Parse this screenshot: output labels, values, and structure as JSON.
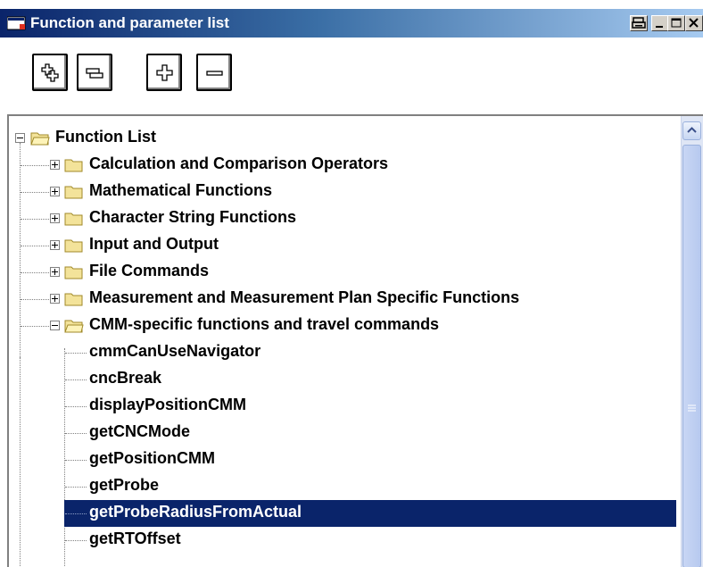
{
  "window": {
    "title": "Function and parameter list",
    "title_buttons": [
      "print-icon",
      "minimize-icon",
      "maximize-icon",
      "close-icon"
    ],
    "colors": {
      "title_start": "#0a246a",
      "title_end": "#a6caf0",
      "selection": "#0a246a"
    }
  },
  "toolbar": {
    "buttons": [
      "expand-all-icon",
      "collapse-all-icon",
      "expand-icon",
      "collapse-icon"
    ]
  },
  "tree": {
    "root": {
      "label": "Function List",
      "state": "expanded"
    },
    "categories": [
      {
        "label": "Calculation and Comparison Operators",
        "state": "collapsed"
      },
      {
        "label": "Mathematical Functions",
        "state": "collapsed"
      },
      {
        "label": "Character String Functions",
        "state": "collapsed"
      },
      {
        "label": "Input and Output",
        "state": "collapsed"
      },
      {
        "label": "File Commands",
        "state": "collapsed"
      },
      {
        "label": "Measurement and Measurement Plan Specific Functions",
        "state": "collapsed"
      },
      {
        "label": "CMM-specific functions and travel commands",
        "state": "expanded"
      }
    ],
    "items": [
      {
        "label": "cmmCanUseNavigator"
      },
      {
        "label": "cncBreak"
      },
      {
        "label": "displayPositionCMM"
      },
      {
        "label": "getCNCMode"
      },
      {
        "label": "getPositionCMM"
      },
      {
        "label": "getProbe"
      },
      {
        "label": "getProbeRadiusFromActual",
        "selected": true
      },
      {
        "label": "getRTOffset"
      }
    ]
  }
}
